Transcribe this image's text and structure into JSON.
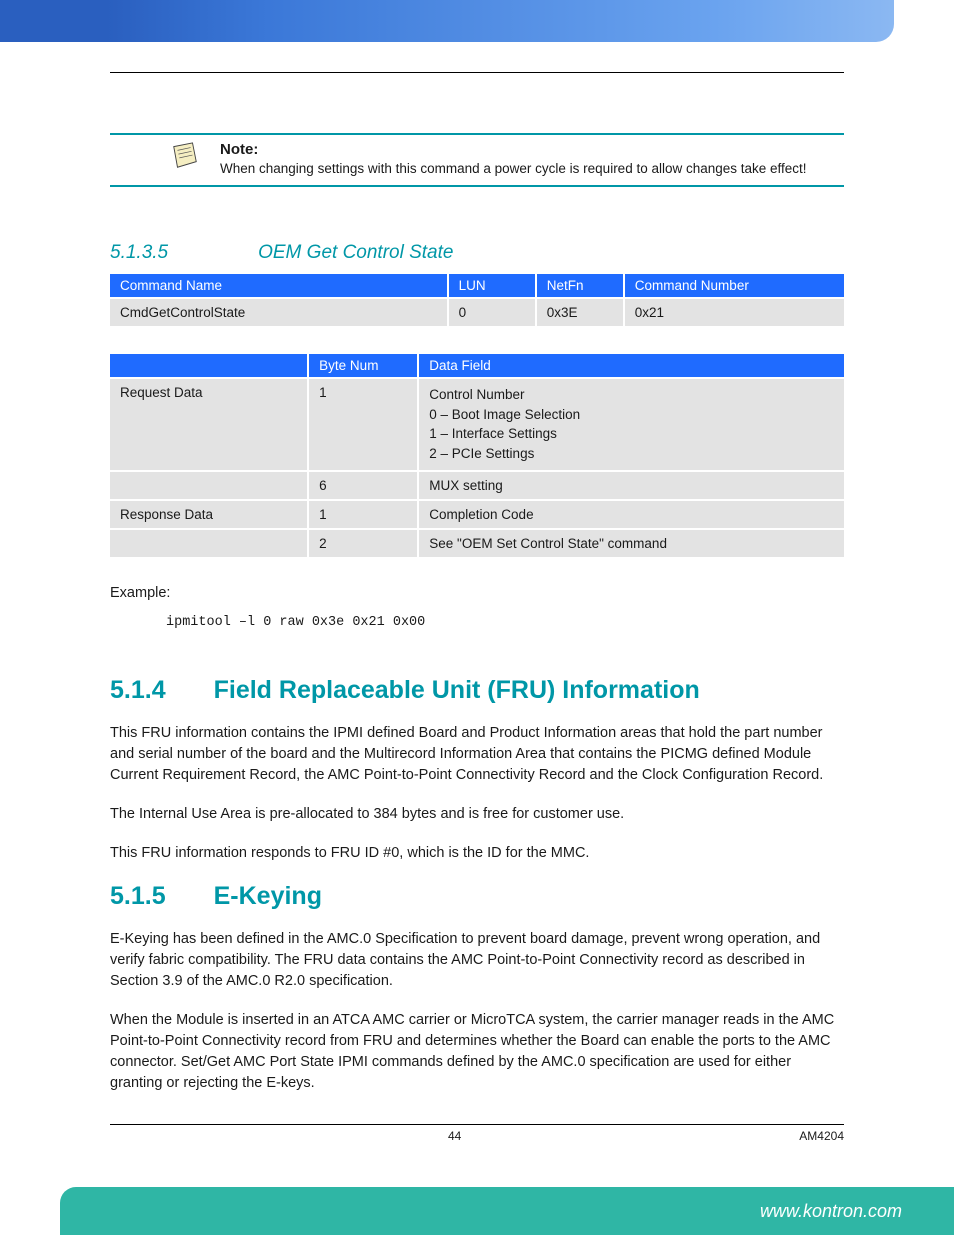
{
  "note": {
    "title": "Note:",
    "body": "When changing settings with this command a power cycle is required to allow changes take effect!"
  },
  "section5135": {
    "num": "5.1.3.5",
    "title": "OEM Get Control State"
  },
  "cmdTable": {
    "headers": [
      "Command Name",
      "LUN",
      "NetFn",
      "Command Number"
    ],
    "row": [
      "CmdGetControlState",
      "0",
      "0x3E",
      "0x21"
    ]
  },
  "dataTable": {
    "headers": [
      "",
      "Byte Num",
      "Data Field"
    ],
    "rows": [
      {
        "c0": "Request Data",
        "c1": "1",
        "c2": "Control Number\n0 – Boot Image Selection\n1 – Interface Settings\n2 – PCIe Settings"
      },
      {
        "c0": "",
        "c1": "6",
        "c2": "MUX setting"
      },
      {
        "c0": "Response Data",
        "c1": "1",
        "c2": "Completion Code"
      },
      {
        "c0": "",
        "c1": "2",
        "c2": "See \"OEM Set  Control State\" command"
      }
    ]
  },
  "example": {
    "label": "Example:",
    "code": "ipmitool –l 0 raw 0x3e 0x21 0x00"
  },
  "section514": {
    "num": "5.1.4",
    "title": "Field Replaceable Unit (FRU) Information",
    "p1": "This FRU information contains the IPMI defined Board and Product Information areas that hold the part number and serial number of the board and the Multirecord Information Area that contains the PICMG defined Module Current Requirement Record, the AMC Point-to-Point Connectivity Record and the Clock Configuration Record.",
    "p2": "The Internal Use Area is pre-allocated to 384 bytes and is free for customer use.",
    "p3": "This FRU information responds to FRU ID #0, which is the ID for the MMC."
  },
  "section515": {
    "num": "5.1.5",
    "title": "E-Keying",
    "p1": "E-Keying has been defined in the AMC.0 Specification to prevent board damage, prevent wrong operation, and verify fabric compatibility. The FRU data contains the AMC Point-to-Point Connectivity record as described in Section 3.9 of the AMC.0 R2.0 specification.",
    "p2": "When the Module is inserted in an ATCA AMC carrier or MicroTCA system, the carrier manager reads in the AMC Point-to-Point Connectivity record from FRU and determines whether the Board can enable the ports to the AMC connector. Set/Get AMC Port State IPMI commands defined by the AMC.0 specification are used for either granting or rejecting the E-keys."
  },
  "footer": {
    "page": "44",
    "doc": "AM4204",
    "url": "www.kontron.com"
  }
}
